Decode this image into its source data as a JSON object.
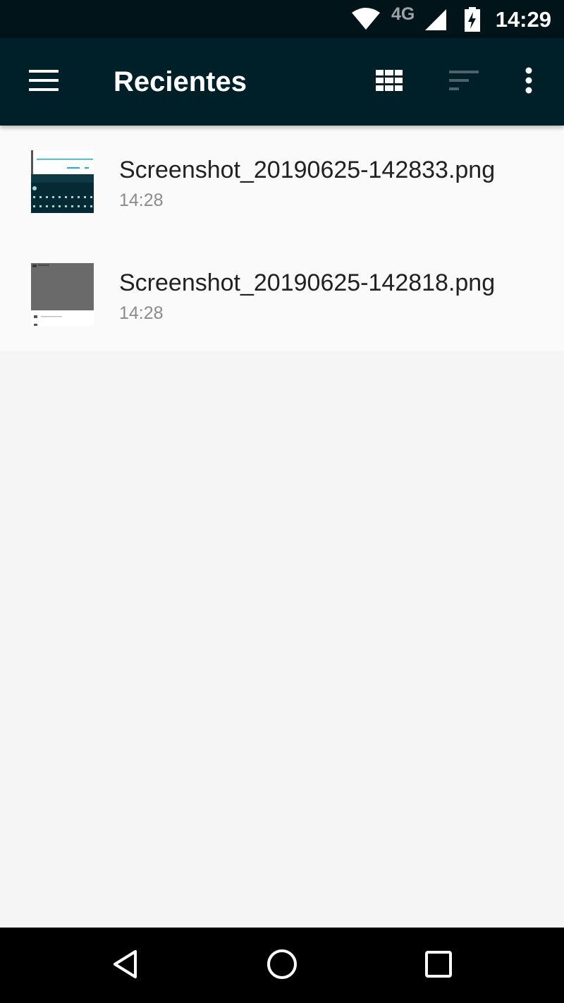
{
  "status_bar": {
    "network_type": "4G",
    "time": "14:29",
    "icons": [
      "wifi-icon",
      "cell-signal-icon",
      "battery-charging-icon"
    ]
  },
  "toolbar": {
    "title": "Recientes",
    "icons": [
      "menu-icon",
      "grid-view-icon",
      "sort-icon",
      "more-vert-icon"
    ],
    "colors": {
      "background": "#002029",
      "status_bar": "#01141a",
      "sort_icon_disabled": "#4e6168"
    }
  },
  "files": [
    {
      "name": "Screenshot_20190625-142833.png",
      "time": "14:28",
      "thumbnail_icon": "image-thumbnail-keyboard"
    },
    {
      "name": "Screenshot_20190625-142818.png",
      "time": "14:28",
      "thumbnail_icon": "image-thumbnail-dialog"
    }
  ],
  "nav_bar": {
    "icons": [
      "back-icon",
      "home-icon",
      "recents-icon"
    ]
  }
}
